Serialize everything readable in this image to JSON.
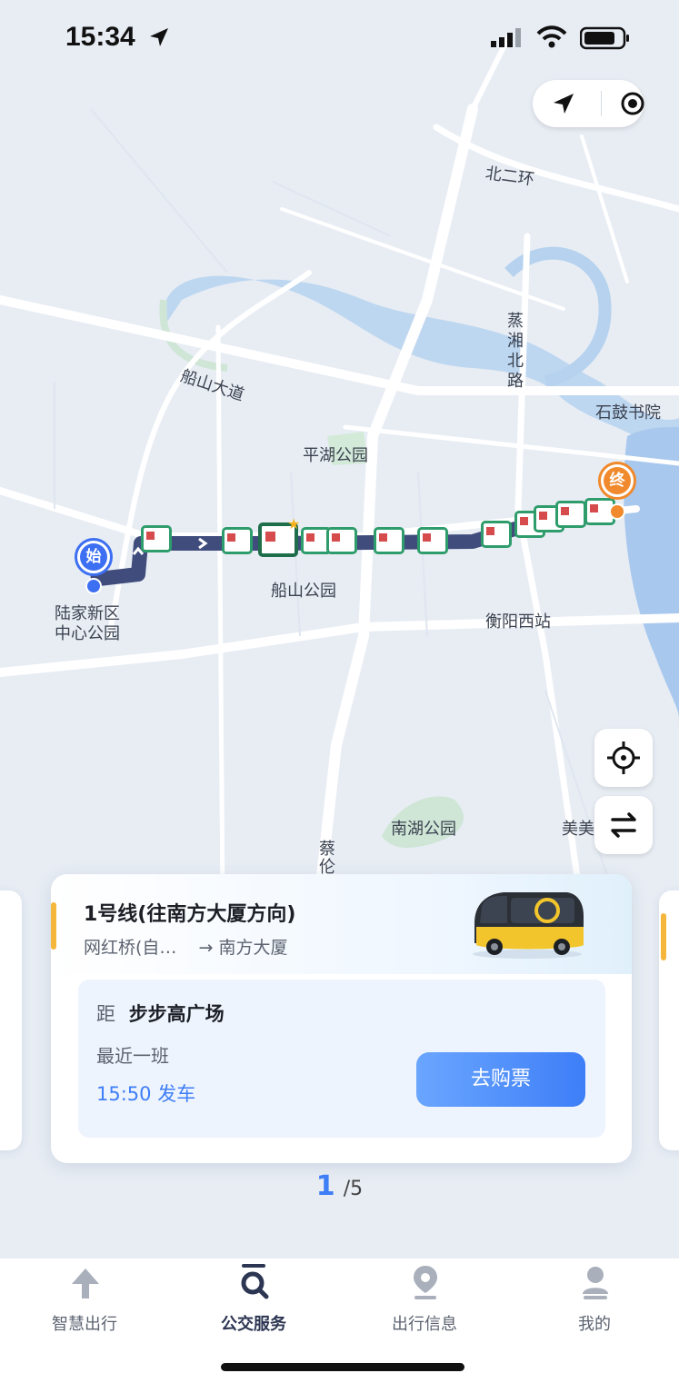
{
  "status_bar": {
    "time": "15:34"
  },
  "map": {
    "labels": {
      "road_north": "北二环",
      "road_chuanshan": "船山大道",
      "road_zhengxiang_1": "蒸",
      "road_zhengxiang_2": "湘",
      "road_zhengxiang_3": "北",
      "road_zhengxiang_4": "路",
      "shigu": "石鼓书院",
      "pinghu": "平湖公园",
      "chuanshan_park": "船山公园",
      "hengyang_west": "衡阳西站",
      "nanhu": "南湖公园",
      "mei": "美美",
      "cailun_1": "蔡",
      "cailun_2": "伦",
      "start_name_1": "陆家新区",
      "start_name_2": "中心公园"
    },
    "markers": {
      "start": "始",
      "end": "终"
    },
    "icons": {
      "navigate": "navigation-arrow-icon",
      "record": "target-dot-icon",
      "locate": "crosshair-icon",
      "switch": "swap-direction-icon"
    }
  },
  "card": {
    "title": "1号线(往南方大厦方向)",
    "from": "网红桥(自…",
    "arrow": "→",
    "to": "南方大厦",
    "distance_prefix": "距",
    "station": "步步高广场",
    "next_label": "最近一班",
    "depart_time": "15:50 发车",
    "buy_button": "去购票"
  },
  "pager": {
    "current": "1",
    "total": "/5"
  },
  "tabs": [
    {
      "label": "智慧出行",
      "icon": "arrow-up-icon",
      "active": false
    },
    {
      "label": "公交服务",
      "icon": "search-icon",
      "active": true
    },
    {
      "label": "出行信息",
      "icon": "location-pin-icon",
      "active": false
    },
    {
      "label": "我的",
      "icon": "user-icon",
      "active": false
    }
  ],
  "colors": {
    "route": "#3f4c7c",
    "accent": "#3e7ef7",
    "start_marker": "#3d6ff2",
    "end_marker": "#f08a2c",
    "stop_green": "#2f9c6c",
    "active_tab": "#2c3552",
    "inactive_tab": "#8f96a3"
  }
}
